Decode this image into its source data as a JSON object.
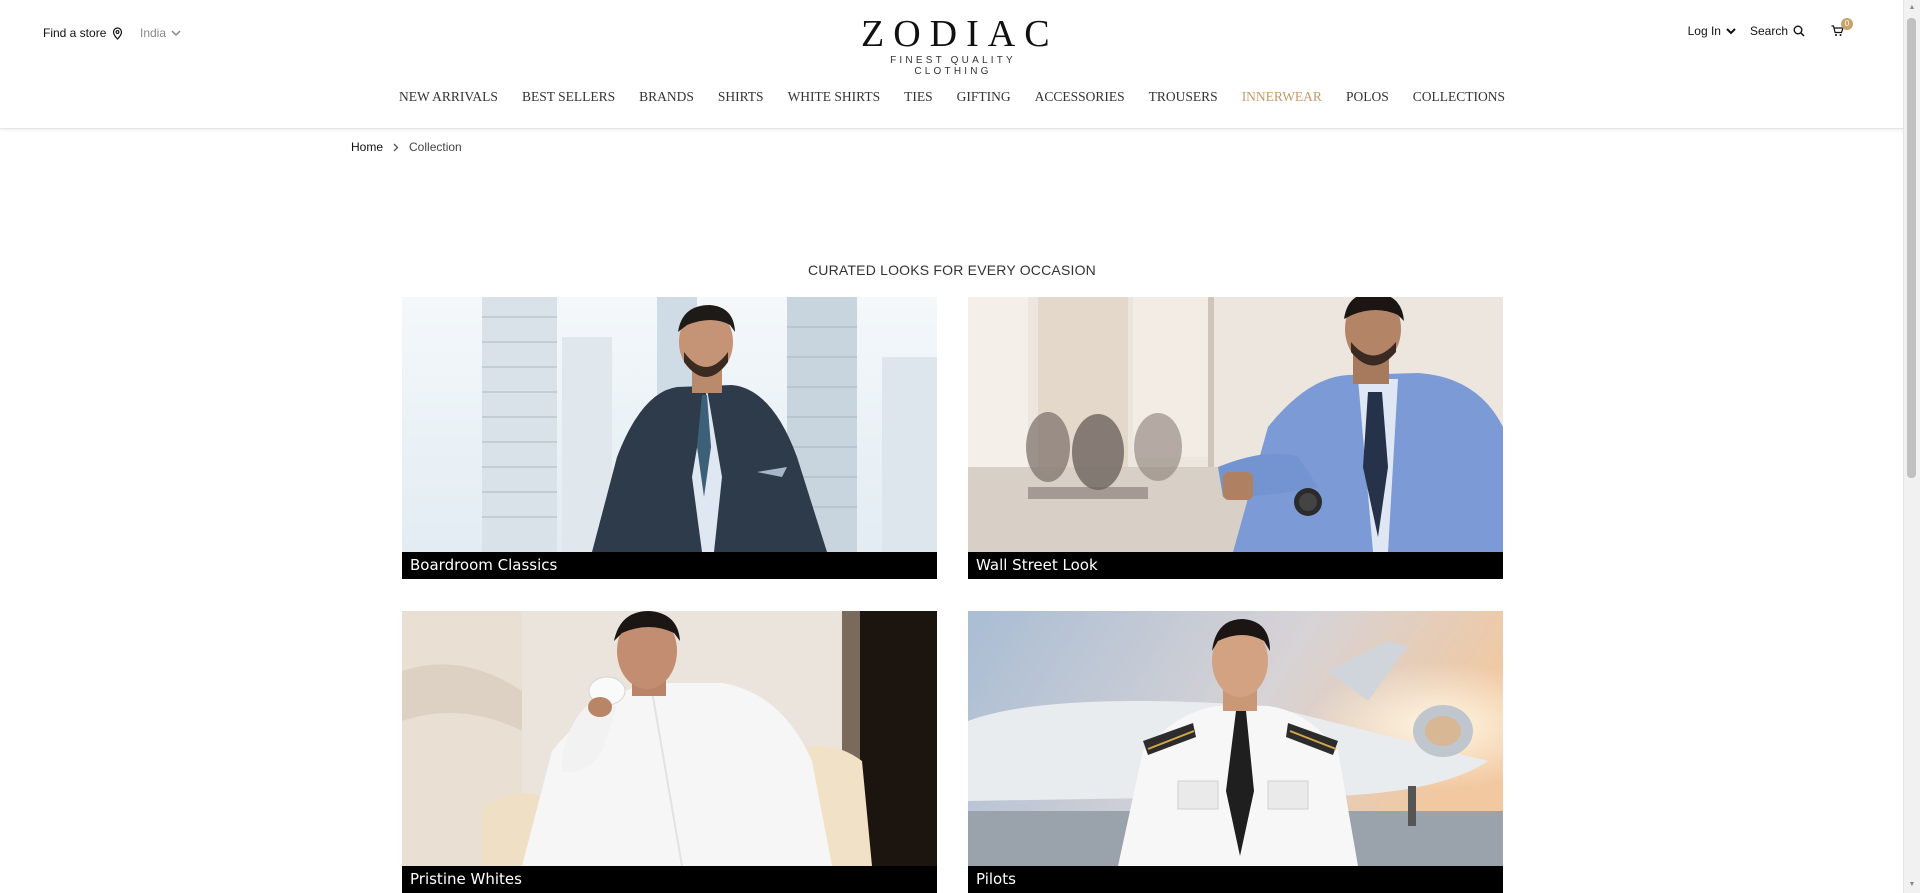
{
  "header": {
    "find_store": "Find a store",
    "country": "India",
    "logo_main": "ZODIAC",
    "logo_sub": "FINEST QUALITY CLOTHING",
    "login": "Log In",
    "search": "Search",
    "cart_count": "0"
  },
  "nav": {
    "items": [
      "NEW ARRIVALS",
      "BEST SELLERS",
      "BRANDS",
      "SHIRTS",
      "WHITE SHIRTS",
      "TIES",
      "GIFTING",
      "ACCESSORIES",
      "TROUSERS",
      "INNERWEAR",
      "POLOS",
      "COLLECTIONS"
    ],
    "active_index": 9,
    "active_color": "#c29a6a"
  },
  "breadcrumb": {
    "home": "Home",
    "current": "Collection"
  },
  "section": {
    "title": "CURATED LOOKS FOR EVERY OCCASION",
    "cards": [
      {
        "label": "Boardroom Classics"
      },
      {
        "label": "Wall Street Look"
      },
      {
        "label": "Pristine Whites"
      },
      {
        "label": "Pilots"
      }
    ]
  }
}
